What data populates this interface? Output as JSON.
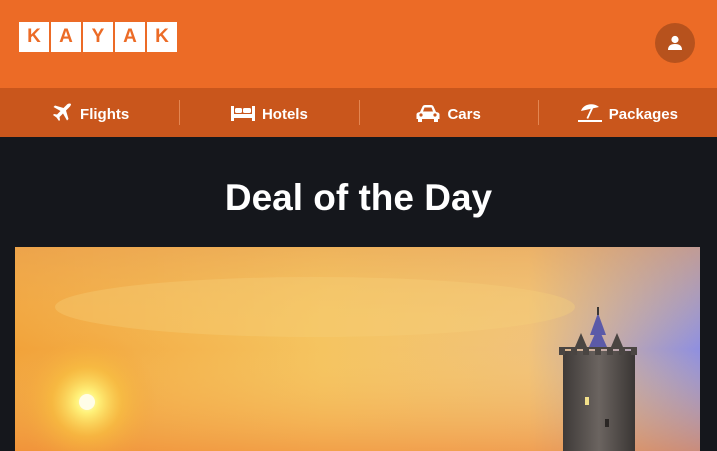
{
  "header": {
    "logo_letters": [
      "K",
      "A",
      "Y",
      "A",
      "K"
    ],
    "account_icon": "user-icon"
  },
  "nav": {
    "items": [
      {
        "label": "Flights",
        "icon": "airplane-icon"
      },
      {
        "label": "Hotels",
        "icon": "bed-icon"
      },
      {
        "label": "Cars",
        "icon": "car-icon"
      },
      {
        "label": "Packages",
        "icon": "beach-umbrella-icon"
      }
    ]
  },
  "main": {
    "title": "Deal of the Day",
    "hero_image": "castle-tower-sunset-photo"
  },
  "colors": {
    "brand_orange": "#ec6b26",
    "nav_orange": "#c9561c",
    "background": "#15171c"
  }
}
